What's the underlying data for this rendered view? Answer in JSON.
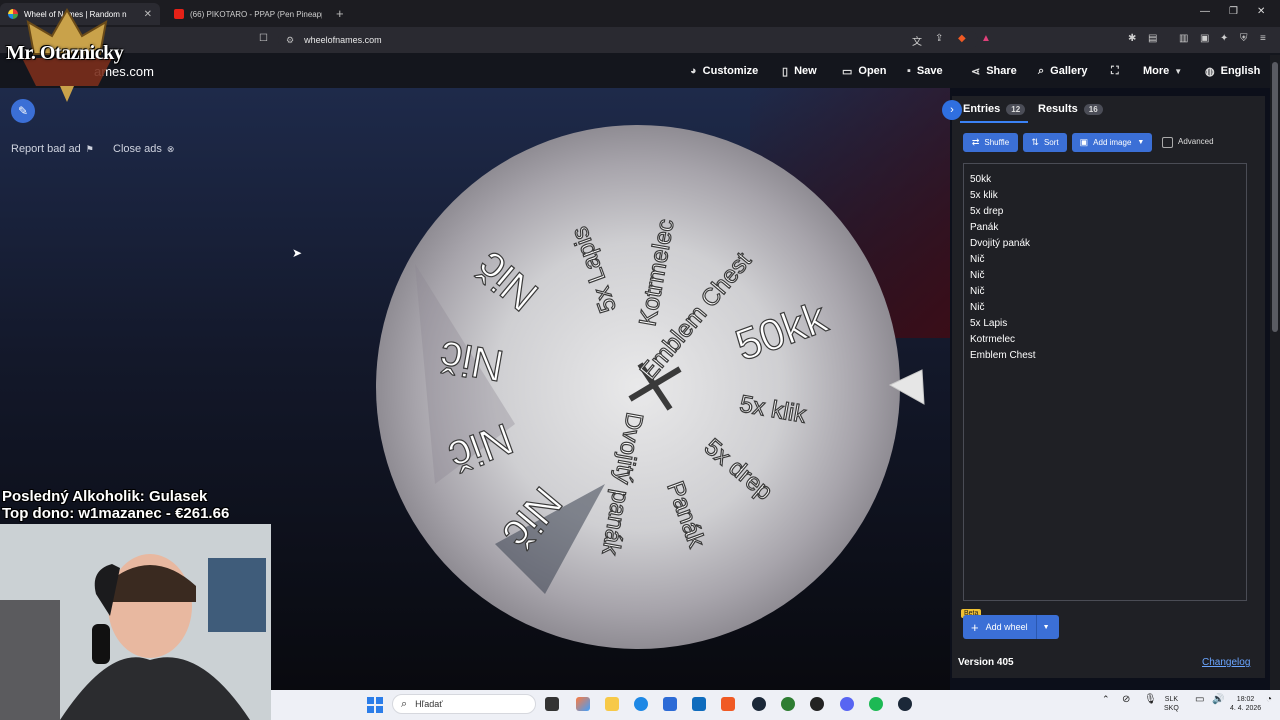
{
  "browser": {
    "tabs": [
      {
        "title": "Wheel of Names | Random n",
        "active": true
      },
      {
        "title": "(66) PIKOTARO - PPAP (Pen Pineapple",
        "active": false
      }
    ],
    "url": "wheelofnames.com"
  },
  "overlay": {
    "channel": "Mr. Otaznicky",
    "last_drinker": "Posledný Alkoholik: Gulasek",
    "top_donor": "Top dono: w1mazanec - €261.66"
  },
  "site": {
    "logo": "wheelofnames.com",
    "logo_visible": "ames.com",
    "nav": {
      "customize": "Customize",
      "new": "New",
      "open": "Open",
      "save": "Save",
      "share": "Share",
      "gallery": "Gallery",
      "more": "More",
      "language": "English"
    },
    "report_ad": "Report bad ad",
    "close_ads": "Close ads"
  },
  "wheel": {
    "labels": [
      "50kk",
      "5x klik",
      "5x drep",
      "Panák",
      "Dvojitý panák",
      "Nič",
      "Nič",
      "Nič",
      "Nič",
      "5x Lapis",
      "Kotrmelec",
      "Emblem Chest"
    ]
  },
  "panel": {
    "entries_tab": "Entries",
    "entries_count": "12",
    "results_tab": "Results",
    "results_count": "16",
    "shuffle": "Shuffle",
    "sort": "Sort",
    "add_image": "Add image",
    "advanced": "Advanced",
    "entries": [
      "50kk",
      "5x klik",
      "5x drep",
      "Panák",
      "Dvojitý panák",
      "Nič",
      "Nič",
      "Nič",
      "Nič",
      "5x Lapis",
      "Kotrmelec",
      "Emblem Chest"
    ],
    "beta": "Beta",
    "add_wheel": "Add wheel",
    "version": "Version 405",
    "changelog": "Changelog"
  },
  "taskbar": {
    "search_placeholder": "Hľadať",
    "lang_line1": "SLK",
    "lang_line2": "SKQ",
    "time": "18:02",
    "date": "4. 4. 2026"
  },
  "colors": {
    "accent": "#3b6fd6",
    "panel": "#1f2025",
    "link": "#6aa5ff"
  }
}
